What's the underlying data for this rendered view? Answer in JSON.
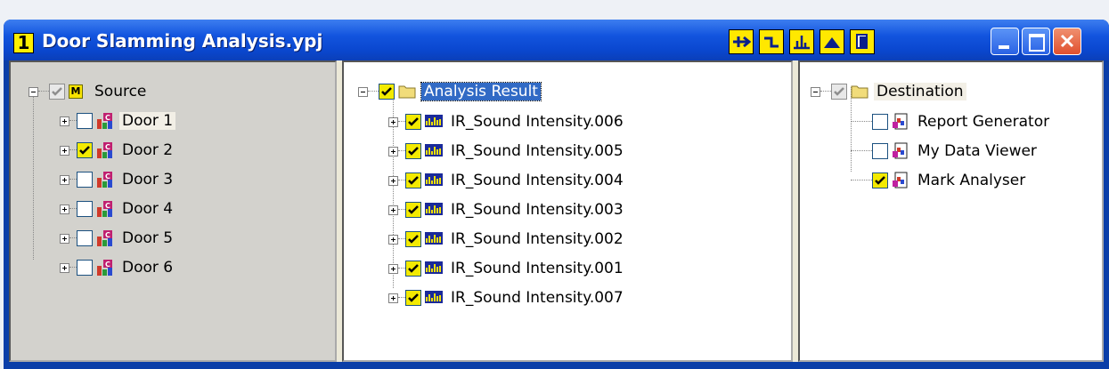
{
  "window": {
    "app_number": "1",
    "title": "Door Slamming Analysis.ypj"
  },
  "toolbar": {
    "buttons": [
      "flow-icon",
      "step-icon",
      "spectrum-icon",
      "peak-icon",
      "copy-icon"
    ]
  },
  "source": {
    "root_label": "Source",
    "items": [
      {
        "label": "Door 1",
        "checked": false
      },
      {
        "label": "Door 2",
        "checked": true
      },
      {
        "label": "Door 3",
        "checked": false
      },
      {
        "label": "Door 4",
        "checked": false
      },
      {
        "label": "Door 5",
        "checked": false
      },
      {
        "label": "Door 6",
        "checked": false
      }
    ]
  },
  "result": {
    "root_label": "Analysis Result",
    "items": [
      {
        "label": "IR_Sound Intensity.006",
        "checked": true
      },
      {
        "label": "IR_Sound Intensity.005",
        "checked": true
      },
      {
        "label": "IR_Sound Intensity.004",
        "checked": true
      },
      {
        "label": "IR_Sound Intensity.003",
        "checked": true
      },
      {
        "label": "IR_Sound Intensity.002",
        "checked": true
      },
      {
        "label": "IR_Sound Intensity.001",
        "checked": true
      },
      {
        "label": "IR_Sound Intensity.007",
        "checked": true
      }
    ]
  },
  "destination": {
    "root_label": "Destination",
    "items": [
      {
        "label": "Report Generator",
        "checked": false
      },
      {
        "label": "My Data Viewer",
        "checked": false
      },
      {
        "label": "Mark Analyser",
        "checked": true
      }
    ]
  },
  "colors": {
    "title_bar": "#0a47cf",
    "toolbar_yellow": "#ffe800",
    "selection": "#316ac5"
  }
}
